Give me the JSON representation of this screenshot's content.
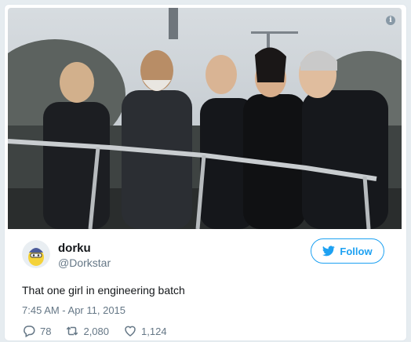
{
  "tweet": {
    "author_name": "dorku",
    "author_handle": "@Dorkstar",
    "follow_label": "Follow",
    "text": "That one girl in engineering batch",
    "timestamp": "7:45 AM - Apr 11, 2015",
    "info_icon": "i",
    "replies": "78",
    "retweets": "2,080",
    "likes": "1,124"
  },
  "colors": {
    "accent": "#1da1f2",
    "secondary_text": "#657786",
    "primary_text": "#14171a"
  },
  "icons": [
    "info-icon",
    "bird-icon",
    "reply-icon",
    "retweet-icon",
    "heart-icon"
  ]
}
